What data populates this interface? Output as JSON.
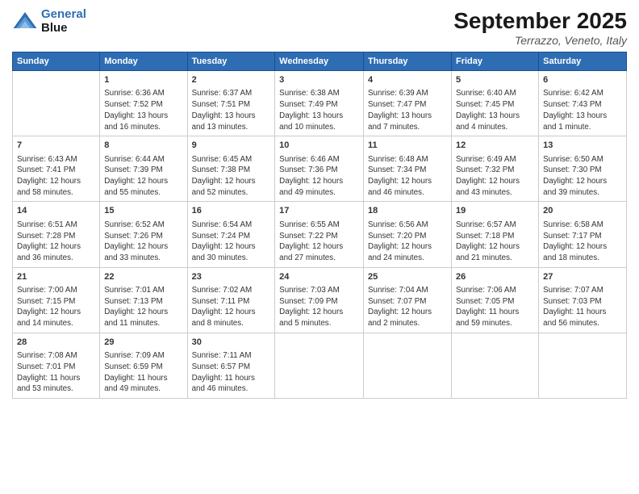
{
  "header": {
    "logo_line1": "General",
    "logo_line2": "Blue",
    "month_title": "September 2025",
    "subtitle": "Terrazzo, Veneto, Italy"
  },
  "days_of_week": [
    "Sunday",
    "Monday",
    "Tuesday",
    "Wednesday",
    "Thursday",
    "Friday",
    "Saturday"
  ],
  "weeks": [
    [
      {
        "date": "",
        "text": ""
      },
      {
        "date": "1",
        "text": "Sunrise: 6:36 AM\nSunset: 7:52 PM\nDaylight: 13 hours\nand 16 minutes."
      },
      {
        "date": "2",
        "text": "Sunrise: 6:37 AM\nSunset: 7:51 PM\nDaylight: 13 hours\nand 13 minutes."
      },
      {
        "date": "3",
        "text": "Sunrise: 6:38 AM\nSunset: 7:49 PM\nDaylight: 13 hours\nand 10 minutes."
      },
      {
        "date": "4",
        "text": "Sunrise: 6:39 AM\nSunset: 7:47 PM\nDaylight: 13 hours\nand 7 minutes."
      },
      {
        "date": "5",
        "text": "Sunrise: 6:40 AM\nSunset: 7:45 PM\nDaylight: 13 hours\nand 4 minutes."
      },
      {
        "date": "6",
        "text": "Sunrise: 6:42 AM\nSunset: 7:43 PM\nDaylight: 13 hours\nand 1 minute."
      }
    ],
    [
      {
        "date": "7",
        "text": "Sunrise: 6:43 AM\nSunset: 7:41 PM\nDaylight: 12 hours\nand 58 minutes."
      },
      {
        "date": "8",
        "text": "Sunrise: 6:44 AM\nSunset: 7:39 PM\nDaylight: 12 hours\nand 55 minutes."
      },
      {
        "date": "9",
        "text": "Sunrise: 6:45 AM\nSunset: 7:38 PM\nDaylight: 12 hours\nand 52 minutes."
      },
      {
        "date": "10",
        "text": "Sunrise: 6:46 AM\nSunset: 7:36 PM\nDaylight: 12 hours\nand 49 minutes."
      },
      {
        "date": "11",
        "text": "Sunrise: 6:48 AM\nSunset: 7:34 PM\nDaylight: 12 hours\nand 46 minutes."
      },
      {
        "date": "12",
        "text": "Sunrise: 6:49 AM\nSunset: 7:32 PM\nDaylight: 12 hours\nand 43 minutes."
      },
      {
        "date": "13",
        "text": "Sunrise: 6:50 AM\nSunset: 7:30 PM\nDaylight: 12 hours\nand 39 minutes."
      }
    ],
    [
      {
        "date": "14",
        "text": "Sunrise: 6:51 AM\nSunset: 7:28 PM\nDaylight: 12 hours\nand 36 minutes."
      },
      {
        "date": "15",
        "text": "Sunrise: 6:52 AM\nSunset: 7:26 PM\nDaylight: 12 hours\nand 33 minutes."
      },
      {
        "date": "16",
        "text": "Sunrise: 6:54 AM\nSunset: 7:24 PM\nDaylight: 12 hours\nand 30 minutes."
      },
      {
        "date": "17",
        "text": "Sunrise: 6:55 AM\nSunset: 7:22 PM\nDaylight: 12 hours\nand 27 minutes."
      },
      {
        "date": "18",
        "text": "Sunrise: 6:56 AM\nSunset: 7:20 PM\nDaylight: 12 hours\nand 24 minutes."
      },
      {
        "date": "19",
        "text": "Sunrise: 6:57 AM\nSunset: 7:18 PM\nDaylight: 12 hours\nand 21 minutes."
      },
      {
        "date": "20",
        "text": "Sunrise: 6:58 AM\nSunset: 7:17 PM\nDaylight: 12 hours\nand 18 minutes."
      }
    ],
    [
      {
        "date": "21",
        "text": "Sunrise: 7:00 AM\nSunset: 7:15 PM\nDaylight: 12 hours\nand 14 minutes."
      },
      {
        "date": "22",
        "text": "Sunrise: 7:01 AM\nSunset: 7:13 PM\nDaylight: 12 hours\nand 11 minutes."
      },
      {
        "date": "23",
        "text": "Sunrise: 7:02 AM\nSunset: 7:11 PM\nDaylight: 12 hours\nand 8 minutes."
      },
      {
        "date": "24",
        "text": "Sunrise: 7:03 AM\nSunset: 7:09 PM\nDaylight: 12 hours\nand 5 minutes."
      },
      {
        "date": "25",
        "text": "Sunrise: 7:04 AM\nSunset: 7:07 PM\nDaylight: 12 hours\nand 2 minutes."
      },
      {
        "date": "26",
        "text": "Sunrise: 7:06 AM\nSunset: 7:05 PM\nDaylight: 11 hours\nand 59 minutes."
      },
      {
        "date": "27",
        "text": "Sunrise: 7:07 AM\nSunset: 7:03 PM\nDaylight: 11 hours\nand 56 minutes."
      }
    ],
    [
      {
        "date": "28",
        "text": "Sunrise: 7:08 AM\nSunset: 7:01 PM\nDaylight: 11 hours\nand 53 minutes."
      },
      {
        "date": "29",
        "text": "Sunrise: 7:09 AM\nSunset: 6:59 PM\nDaylight: 11 hours\nand 49 minutes."
      },
      {
        "date": "30",
        "text": "Sunrise: 7:11 AM\nSunset: 6:57 PM\nDaylight: 11 hours\nand 46 minutes."
      },
      {
        "date": "",
        "text": ""
      },
      {
        "date": "",
        "text": ""
      },
      {
        "date": "",
        "text": ""
      },
      {
        "date": "",
        "text": ""
      }
    ]
  ]
}
